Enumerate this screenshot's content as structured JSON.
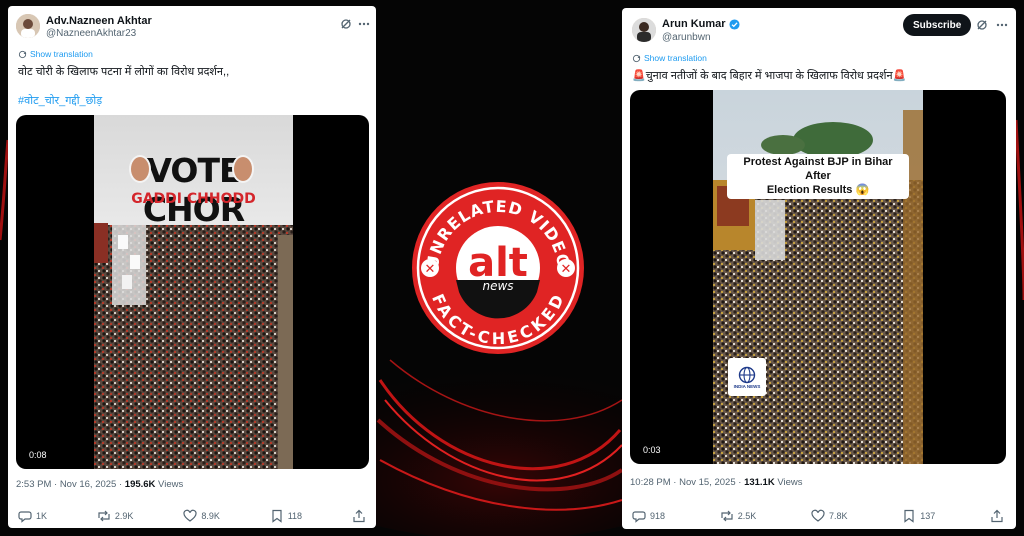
{
  "left_post": {
    "author_name": "Adv.Nazneen Akhtar",
    "author_handle": "@NazneenAkhtar23",
    "show_translation": "Show translation",
    "text": "वोट चोरी के खिलाफ पटना में लोगों का विरोध प्रदर्शन,,",
    "hashtag": "#वोट_चोर_गद्दी_छोड़",
    "video_overlay_title": "VOTE CHOR",
    "video_overlay_subtitle": "GADDI CHHODD",
    "video_duration": "0:08",
    "timestamp": "2:53 PM · Nov 16, 2025 · ",
    "views_count": "195.6K",
    "views_label": " Views",
    "replies": "1K",
    "reposts": "2.9K",
    "likes": "8.9K",
    "bookmarks": "118"
  },
  "right_post": {
    "author_name": "Arun Kumar",
    "author_handle": "@arunbwn",
    "subscribe_label": "Subscribe",
    "show_translation": "Show translation",
    "text": "🚨चुनाव नतीजों के बाद बिहार में भाजपा के खिलाफ विरोध प्रदर्शन🚨",
    "video_caption_line1": "Protest Against BJP in Bihar After",
    "video_caption_line2": "Election Results 😱",
    "watermark_label": "INDIA NEWS",
    "video_duration": "0:03",
    "timestamp": "10:28 PM · Nov 15, 2025 · ",
    "views_count": "131.1K",
    "views_label": " Views",
    "replies": "918",
    "reposts": "2.5K",
    "likes": "7.8K",
    "bookmarks": "137"
  },
  "badge": {
    "top_text": "UNRELATED VIDEO",
    "logo_text": "alt",
    "logo_subtext": "news",
    "bottom_text": "FACT-CHECKED",
    "mark": "✕"
  },
  "colors": {
    "badge_red": "#e02424",
    "link_blue": "#1d9bf0",
    "verified_blue": "#1d9bf0",
    "background": "#050505",
    "swirl_red": "#d11a1a"
  },
  "icons": {
    "grok": "grok-icon",
    "more": "more-icon",
    "translate": "translate-icon",
    "reply": "reply-icon",
    "repost": "repost-icon",
    "like": "like-icon",
    "bookmark": "bookmark-icon",
    "share": "share-icon",
    "verified": "verified-icon"
  }
}
